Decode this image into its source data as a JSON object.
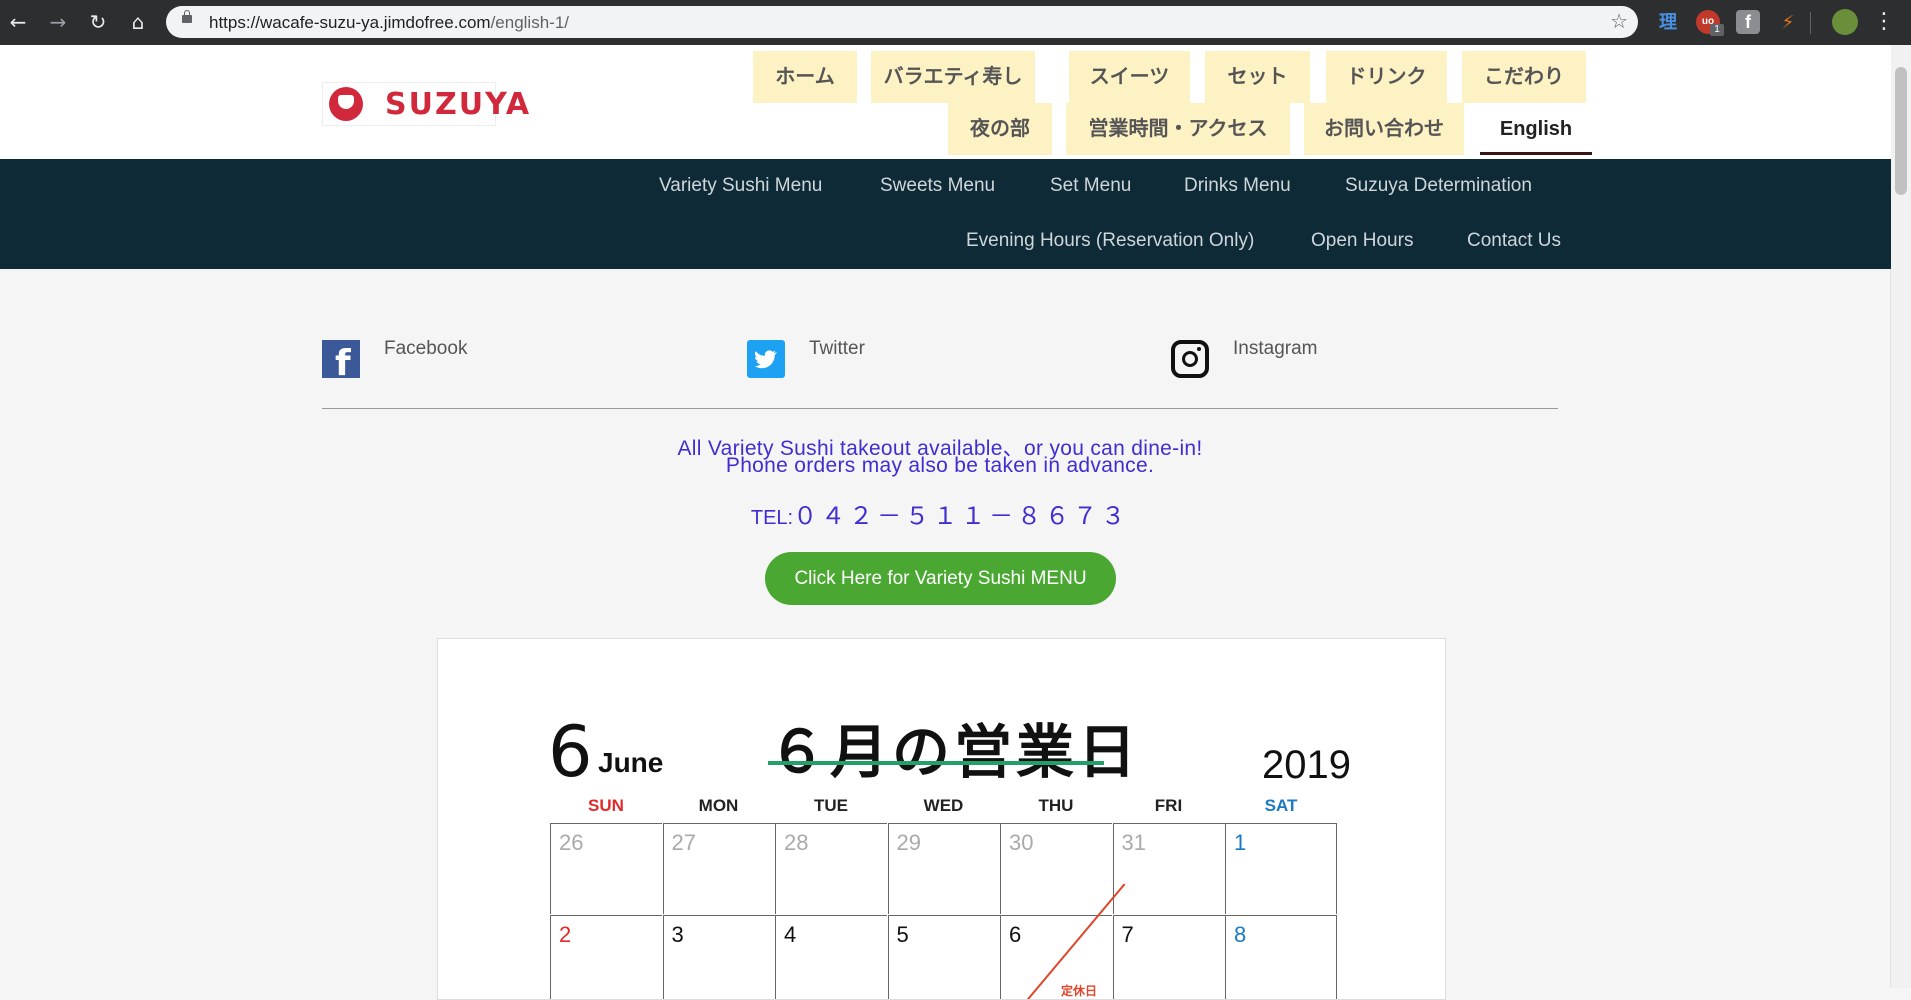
{
  "browser": {
    "url_host": "https://wacafe-suzu-ya.jimdofree.com",
    "url_path": "/english-1/",
    "nav_icons": [
      "back-arrow-icon",
      "forward-arrow-icon",
      "reload-icon",
      "home-icon"
    ],
    "extensions": [
      {
        "name": "rikaikun-extension-icon",
        "glyph": "理",
        "color": "#4a90e2"
      },
      {
        "name": "ublock-extension-icon",
        "glyph": "uo",
        "badge": "1",
        "color": "#c0392b"
      },
      {
        "name": "facebook-extension-icon",
        "glyph": "f",
        "color": "#8a8d91"
      },
      {
        "name": "pdf-extension-icon",
        "glyph": "⚡",
        "color": "#e8711c"
      }
    ]
  },
  "header": {
    "logo_text": "SUZUYA",
    "tabs_row1": [
      "ホーム",
      "バラエティ寿し",
      "スイーツ",
      "セット",
      "ドリンク",
      "こだわり"
    ],
    "tabs_row2": [
      "夜の部",
      "営業時間・アクセス",
      "お問い合わせ",
      "English"
    ]
  },
  "subnav": {
    "row1": [
      "Variety Sushi Menu",
      "Sweets Menu",
      "Set Menu",
      "Drinks Menu",
      "Suzuya Determination"
    ],
    "row2": [
      "Evening Hours (Reservation Only)",
      "Open Hours",
      "Contact Us"
    ]
  },
  "social": [
    {
      "label": "Facebook",
      "icon": "facebook-icon"
    },
    {
      "label": "Twitter",
      "icon": "twitter-icon"
    },
    {
      "label": "Instagram",
      "icon": "instagram-icon"
    }
  ],
  "promo": {
    "line1": "All Variety Sushi takeout available、or you can dine-in!",
    "line2": "Phone orders may also be taken in advance.",
    "tel_prefix": "TEL:",
    "tel_number": "０４２－５１１－８６７３",
    "button_label": "Click Here for Variety Sushi MENU"
  },
  "calendar": {
    "month_number": "6",
    "month_en": "June",
    "title": "６月の営業日",
    "year": "2019",
    "weekdays": [
      "SUN",
      "MON",
      "TUE",
      "WED",
      "THU",
      "FRI",
      "SAT"
    ],
    "weekday_colors": [
      "#e02a2a",
      "#222",
      "#222",
      "#222",
      "#222",
      "#222",
      "#1a7ac2"
    ],
    "week1": [
      "26",
      "27",
      "28",
      "29",
      "30",
      "31",
      "1"
    ],
    "week2": [
      "2",
      "3",
      "4",
      "5",
      "6",
      "7",
      "8"
    ],
    "closed_label": "定休日"
  }
}
